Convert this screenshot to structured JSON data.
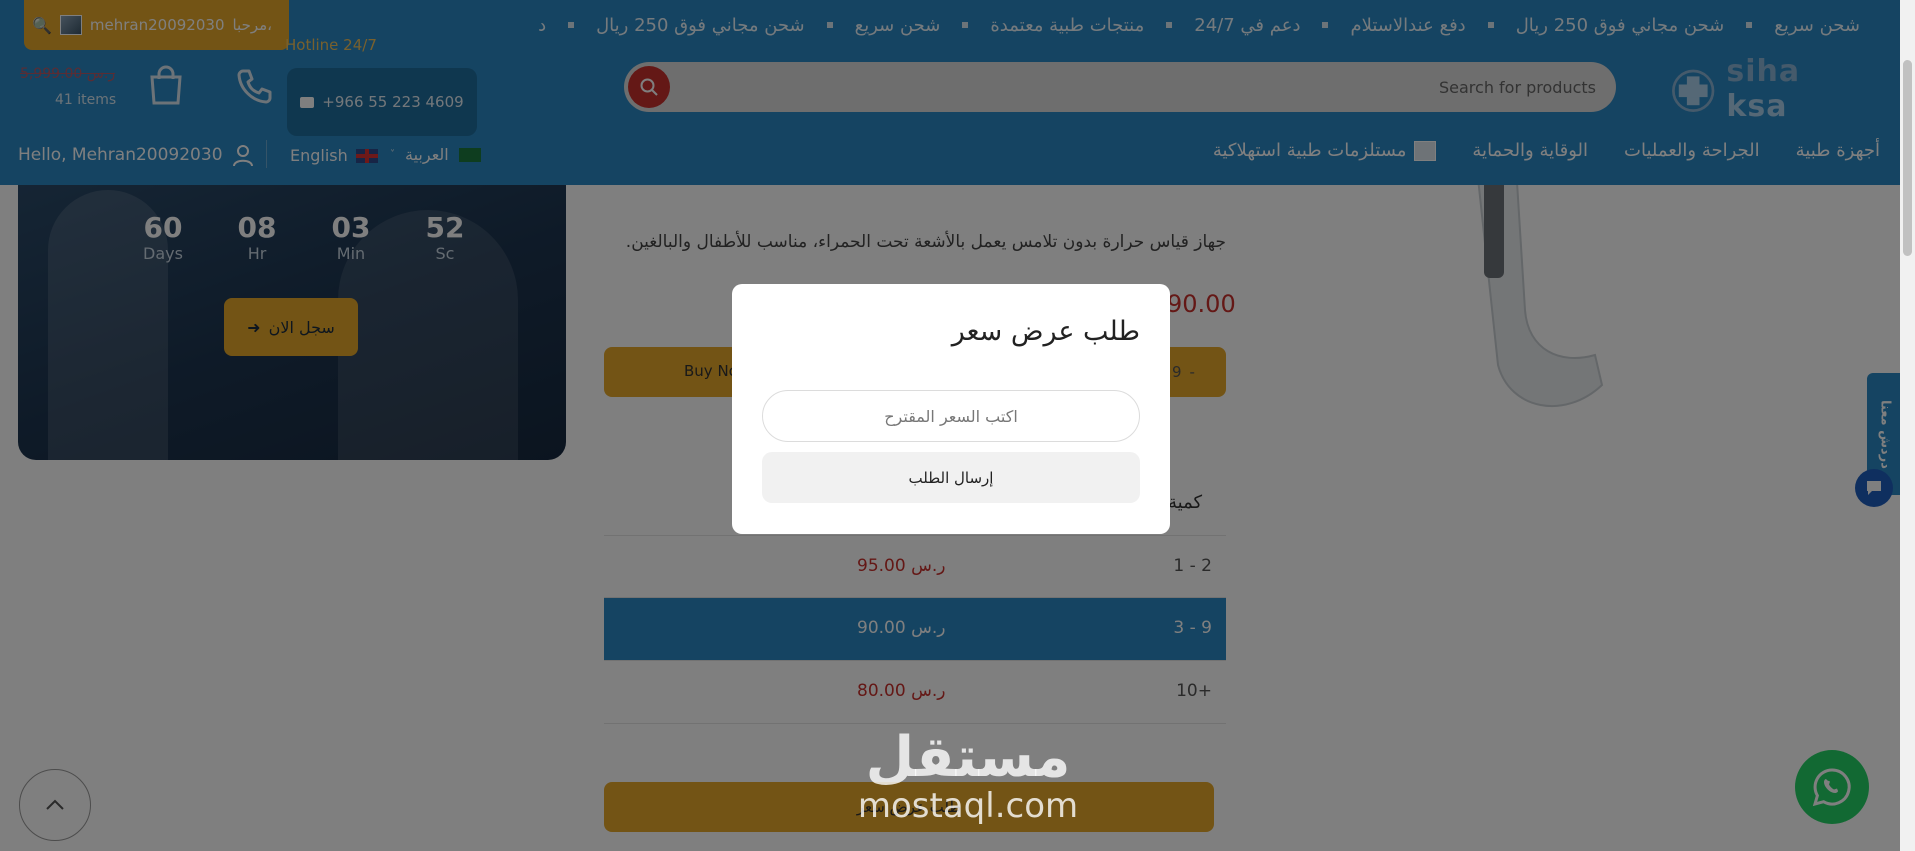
{
  "ticker": {
    "items": [
      "شحن سريع",
      "شحن مجاني فوق 250 ريال",
      "دفع عندالاستلام",
      "دعم في 24/7",
      "منتجات طبية معتمدة",
      "شحن سريع",
      "شحن مجاني فوق 250 ريال",
      "د"
    ]
  },
  "user": {
    "name": "mehran20092030",
    "greeting": "مرحبا،",
    "hello": "Hello, Mehran20092030"
  },
  "contact": {
    "hotline": "Hotline 24/7",
    "phone": "+966 55 223 4609"
  },
  "cart": {
    "total": "5,999.00 ر.س",
    "items": "41 items"
  },
  "search": {
    "placeholder": "Search for products"
  },
  "logo": {
    "brand_main": "siha",
    "brand_sub": "ksa"
  },
  "language": {
    "english": "English",
    "arabic": "العربية"
  },
  "nav": {
    "items": [
      "أجهزة طبية",
      "الجراحة والعمليات",
      "الوقاية والحماية",
      "مستلزمات طبية استهلاكية"
    ]
  },
  "promo": {
    "countdown": [
      {
        "value": "60",
        "label": "Days"
      },
      {
        "value": "08",
        "label": "Hr"
      },
      {
        "value": "03",
        "label": "Min"
      },
      {
        "value": "52",
        "label": "Sc"
      }
    ],
    "register_label": "سجل الان"
  },
  "product": {
    "description": "جهاز قياس حرارة بدون تلامس يعمل بالأشعة تحت الحمراء، مناسب للأطفال والبالغين.",
    "price_fragment": "90.00",
    "buy_label": "Buy No",
    "qty_value": "9",
    "qty_minus": "-",
    "qty_label": "كمية"
  },
  "tiers": [
    {
      "range": "1 - 2",
      "price": "95.00 ر.س",
      "active": false
    },
    {
      "range": "3 - 9",
      "price": "90.00 ر.س",
      "active": true
    },
    {
      "range": "10+",
      "price": "80.00 ر.س",
      "active": false
    }
  ],
  "quote_button": "طلب عرض سعر",
  "chat": {
    "tab_label": "دردش معنا"
  },
  "watermark": {
    "arabic": "مستقل",
    "latin": "mostaql.com"
  },
  "modal": {
    "title": "طلب عرض سعر",
    "input_placeholder": "اكتب السعر المقترح",
    "submit_label": "إرسال الطلب"
  },
  "colors": {
    "primary": "#2a88c4",
    "accent": "#e6a92a",
    "price": "#c9302c",
    "whatsapp": "#25d366"
  }
}
